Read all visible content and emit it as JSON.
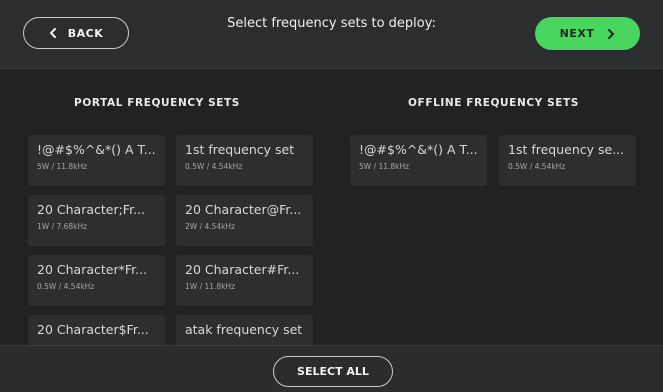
{
  "header": {
    "back_label": "BACK",
    "title": "Select frequency sets to deploy:",
    "next_label": "NEXT",
    "next_color": "#49d65f"
  },
  "portal": {
    "heading": "PORTAL FREQUENCY SETS",
    "sets": [
      {
        "name": "!@#$%^&*() A T...",
        "meta": "5W / 11.8kHz"
      },
      {
        "name": "1st frequency set",
        "meta": "0.5W / 4.54kHz"
      },
      {
        "name": "20 Character;Fr...",
        "meta": "1W / 7.68kHz"
      },
      {
        "name": "20 Character@Fr...",
        "meta": "2W / 4.54kHz"
      },
      {
        "name": "20 Character*Fr...",
        "meta": "0.5W / 4.54kHz"
      },
      {
        "name": "20 Character#Fr...",
        "meta": "1W / 11.8kHz"
      },
      {
        "name": "20 Character$Fr...",
        "meta": ""
      },
      {
        "name": "atak frequency set",
        "meta": ""
      }
    ]
  },
  "offline": {
    "heading": "OFFLINE FREQUENCY SETS",
    "sets": [
      {
        "name": "!@#$%^&*() A T...",
        "meta": "5W / 11.8kHz"
      },
      {
        "name": "1st frequency se...",
        "meta": "0.5W / 4.54kHz"
      }
    ]
  },
  "footer": {
    "select_all_label": "SELECT ALL"
  }
}
